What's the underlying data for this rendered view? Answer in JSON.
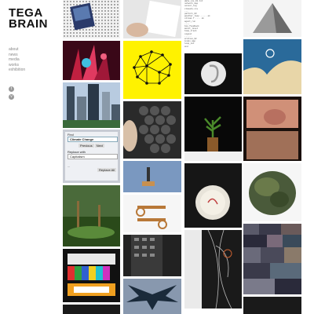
{
  "site": {
    "title_line1": "TEGA",
    "title_line2": "BRAIN"
  },
  "nav": {
    "items": [
      "about",
      "news",
      "media",
      "works",
      "exhibition"
    ]
  },
  "social": {
    "icons": [
      "twitter-icon",
      "vimeo-icon"
    ]
  },
  "screen_tile": {
    "field_label": "Find",
    "field_value": "Climate Change",
    "buttons": [
      "Previous",
      "Next"
    ],
    "replace_label": "Replace with",
    "replace_value": "Capitalism",
    "status_text": "...",
    "replace_all_label": "Replace All"
  },
  "colors": {
    "text": "#111111",
    "nav": "#8a8a8a",
    "yellow": "#fff200",
    "black": "#000000"
  }
}
